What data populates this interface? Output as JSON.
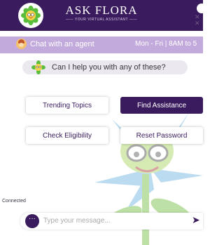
{
  "header": {
    "title": "ASK FLORA",
    "subtitle": "—— YOUR VIRTUAL ASSISTANT ——",
    "close_icon": "close-icon",
    "logo_icon": "flower-logo-icon"
  },
  "agent_bar": {
    "label": "Chat with an agent",
    "hours": "Mon - Fri | 8AM to 5",
    "avatar_icon": "agent-avatar-icon"
  },
  "prompt": {
    "text": "Can I help you with any of these?",
    "icon": "flower-avatar-icon"
  },
  "quick_replies": [
    {
      "label": "Trending Topics",
      "style": "outline"
    },
    {
      "label": "Find Assistance",
      "style": "filled"
    },
    {
      "label": "Check Eligibility",
      "style": "outline"
    },
    {
      "label": "Reset Password",
      "style": "outline"
    }
  ],
  "status": "Connected",
  "composer": {
    "placeholder": "Type your message...",
    "menu_icon": "more-options-icon",
    "send_icon": "send-arrow-icon"
  },
  "colors": {
    "brand": "#3a1c5e",
    "subbar": "#c3aadc",
    "bubble": "#ece8f0"
  }
}
